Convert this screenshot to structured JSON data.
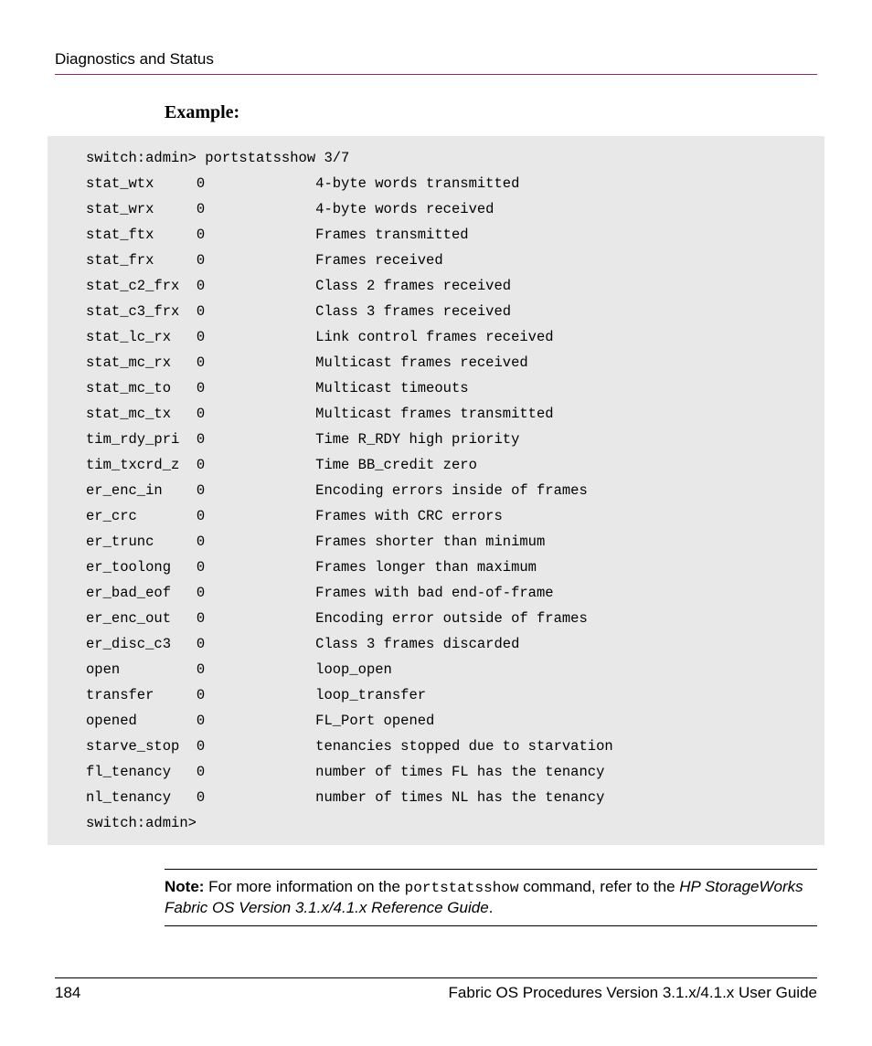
{
  "header": {
    "title": "Diagnostics and Status"
  },
  "example": {
    "label": "Example:",
    "prompt": "switch:admin> portstatsshow 3/7",
    "rows": [
      {
        "name": "stat_wtx",
        "val": "0",
        "desc": "4-byte words transmitted"
      },
      {
        "name": "stat_wrx",
        "val": "0",
        "desc": "4-byte words received"
      },
      {
        "name": "stat_ftx",
        "val": "0",
        "desc": "Frames transmitted"
      },
      {
        "name": "stat_frx",
        "val": "0",
        "desc": "Frames received"
      },
      {
        "name": "stat_c2_frx",
        "val": "0",
        "desc": "Class 2 frames received"
      },
      {
        "name": "stat_c3_frx",
        "val": "0",
        "desc": "Class 3 frames received"
      },
      {
        "name": "stat_lc_rx",
        "val": "0",
        "desc": "Link control frames received"
      },
      {
        "name": "stat_mc_rx",
        "val": "0",
        "desc": "Multicast frames received"
      },
      {
        "name": "stat_mc_to",
        "val": "0",
        "desc": "Multicast timeouts"
      },
      {
        "name": "stat_mc_tx",
        "val": "0",
        "desc": "Multicast frames transmitted"
      },
      {
        "name": "tim_rdy_pri",
        "val": "0",
        "desc": "Time R_RDY high priority"
      },
      {
        "name": "tim_txcrd_z",
        "val": "0",
        "desc": "Time BB_credit zero"
      },
      {
        "name": "er_enc_in",
        "val": "0",
        "desc": "Encoding errors inside of frames"
      },
      {
        "name": "er_crc",
        "val": "0",
        "desc": "Frames with CRC errors"
      },
      {
        "name": "er_trunc",
        "val": "0",
        "desc": "Frames shorter than minimum"
      },
      {
        "name": "er_toolong",
        "val": "0",
        "desc": "Frames longer than maximum"
      },
      {
        "name": "er_bad_eof",
        "val": "0",
        "desc": "Frames with bad end-of-frame"
      },
      {
        "name": "er_enc_out",
        "val": "0",
        "desc": "Encoding error outside of frames"
      },
      {
        "name": "er_disc_c3",
        "val": "0",
        "desc": "Class 3 frames discarded"
      },
      {
        "name": "open",
        "val": "0",
        "desc": "loop_open"
      },
      {
        "name": "transfer",
        "val": "0",
        "desc": "loop_transfer"
      },
      {
        "name": "opened",
        "val": "0",
        "desc": "FL_Port opened"
      },
      {
        "name": "starve_stop",
        "val": "0",
        "desc": "tenancies stopped due to starvation"
      },
      {
        "name": "fl_tenancy",
        "val": "0",
        "desc": "number of times FL has the tenancy"
      },
      {
        "name": "nl_tenancy",
        "val": "0",
        "desc": "number of times NL has the tenancy"
      }
    ],
    "end_prompt": "switch:admin>"
  },
  "note": {
    "label": "Note:",
    "before_cmd": "  For more information on the ",
    "cmd": "portstatsshow",
    "after_cmd": " command, refer to the ",
    "italic": "HP StorageWorks Fabric OS Version 3.1.x/4.1.x Reference Guide",
    "period": "."
  },
  "footer": {
    "page_number": "184",
    "doc_title": "Fabric OS Procedures Version 3.1.x/4.1.x User Guide"
  }
}
